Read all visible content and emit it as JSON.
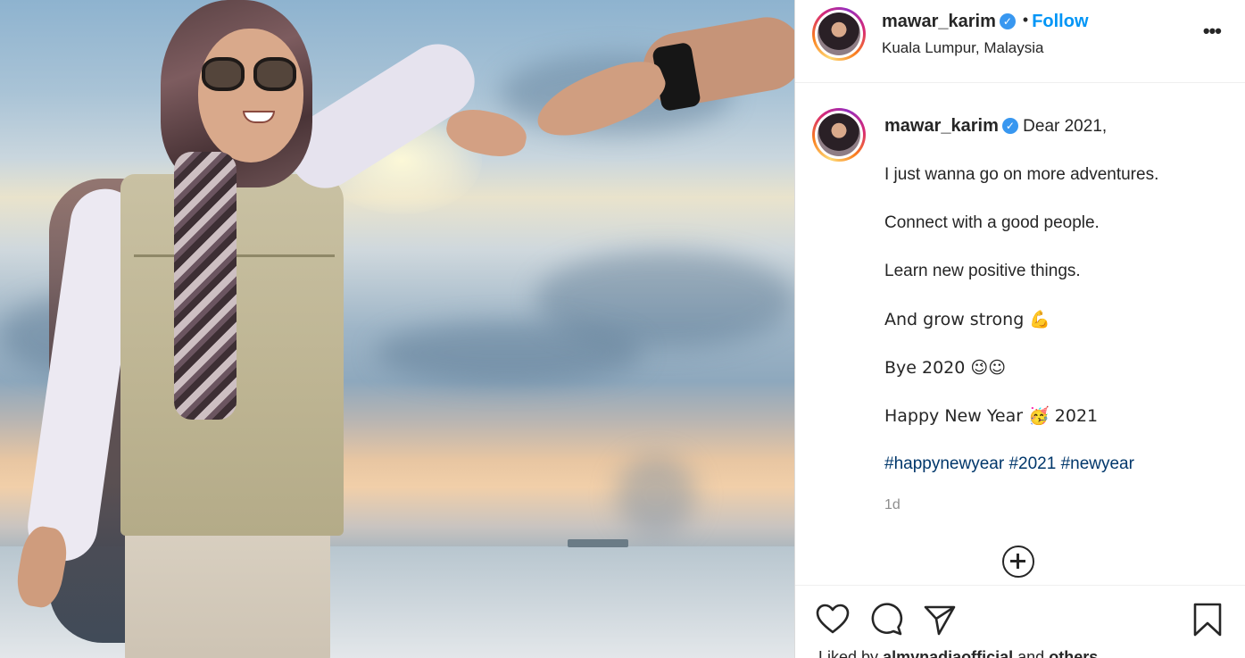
{
  "post": {
    "username": "mawar_karim",
    "verified_icon": "verified-badge-icon",
    "separator": "•",
    "follow_label": "Follow",
    "location": "Kuala Lumpur, Malaysia",
    "more_label": "•••"
  },
  "caption": {
    "username": "mawar_karim",
    "lines": [
      "Dear 2021,",
      "I just wanna go on more adventures.",
      "Connect with a good people.",
      "Learn new positive things.",
      "And grow strong 💪",
      "Bye 2020 😉☺",
      "Happy New Year 🥳 2021"
    ],
    "hashtags": [
      "#happynewyear",
      "#2021",
      "#newyear"
    ],
    "time": "1d"
  },
  "actions": {
    "icons": [
      "heart-icon",
      "comment-icon",
      "share-icon",
      "bookmark-icon"
    ],
    "liked_prefix": "Liked by",
    "liked_user": "almynadiaofficial",
    "liked_and": "and",
    "liked_others": "others"
  },
  "colors": {
    "accent": "#0095f6",
    "hashtag": "#00376b",
    "verified": "#3897f0",
    "muted": "#8e8e8e"
  }
}
